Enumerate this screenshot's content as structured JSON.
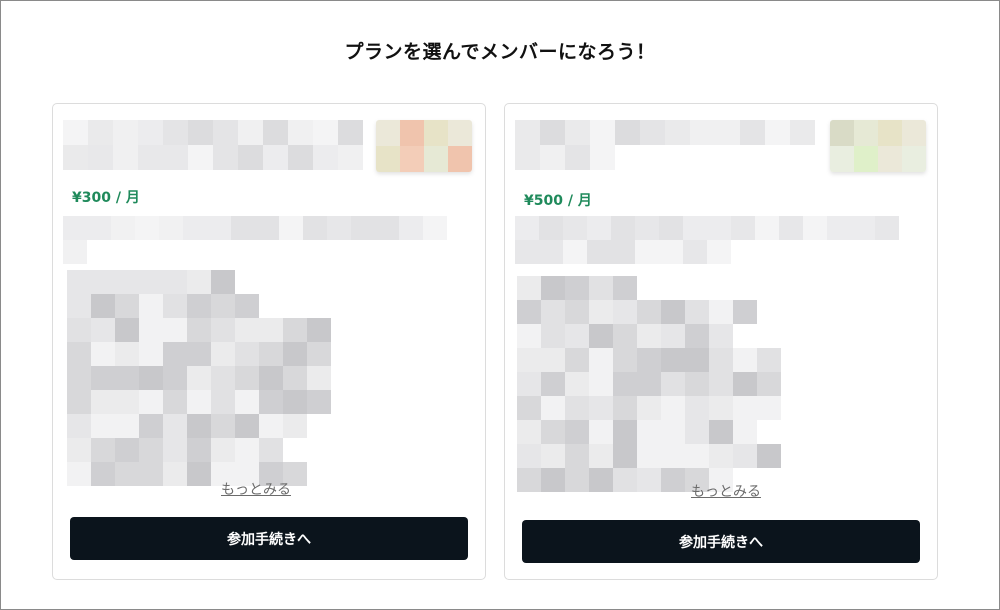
{
  "page": {
    "title": "プランを選んでメンバーになろう！"
  },
  "plans": [
    {
      "price": "¥300 / 月",
      "more_label": "もっとみる",
      "button_label": "参加手続きへ"
    },
    {
      "price": "¥500 / 月",
      "more_label": "もっとみる",
      "button_label": "参加手続きへ"
    }
  ],
  "colors": {
    "accent_price": "#1f8a5b",
    "button_bg": "#0b141c",
    "button_text": "#ffffff",
    "card_border": "#dcdcdc"
  }
}
